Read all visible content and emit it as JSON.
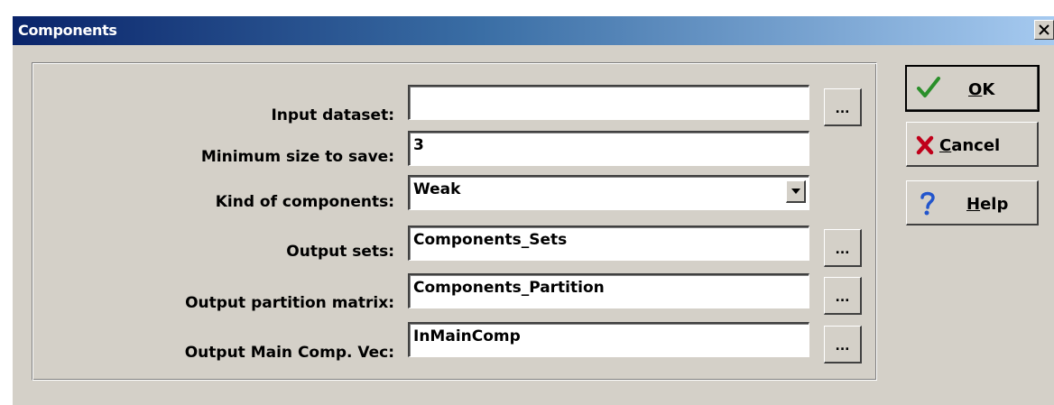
{
  "window": {
    "title": "Components",
    "close_label": "×"
  },
  "form": {
    "fields": [
      {
        "label": "Input dataset:",
        "value": "",
        "browse": "..."
      },
      {
        "label": "Minimum size to save:",
        "value": "3"
      },
      {
        "label": "Kind of components:",
        "value": "Weak",
        "options_visible": [
          "Weak"
        ]
      },
      {
        "label": "Output sets:",
        "value": "Components_Sets",
        "browse": "..."
      },
      {
        "label": "Output partition matrix:",
        "value": "Components_Partition",
        "browse": "..."
      },
      {
        "label": "Output Main Comp. Vec:",
        "value": "InMainComp",
        "browse": "..."
      }
    ]
  },
  "buttons": {
    "ok": {
      "mnemonic": "O",
      "rest": "K",
      "icon": "checkmark-icon"
    },
    "cancel": {
      "mnemonic": "C",
      "rest": "ancel",
      "icon": "x-cross-icon"
    },
    "help": {
      "mnemonic": "H",
      "rest": "elp",
      "icon": "question-icon"
    }
  },
  "colors": {
    "titlebar_start": "#0a246a",
    "titlebar_end": "#a6caf0",
    "dialog_bg": "#d4d0c8",
    "ok_icon": "#2a8f2a",
    "cancel_icon": "#c0001a",
    "help_icon": "#2255cc"
  }
}
